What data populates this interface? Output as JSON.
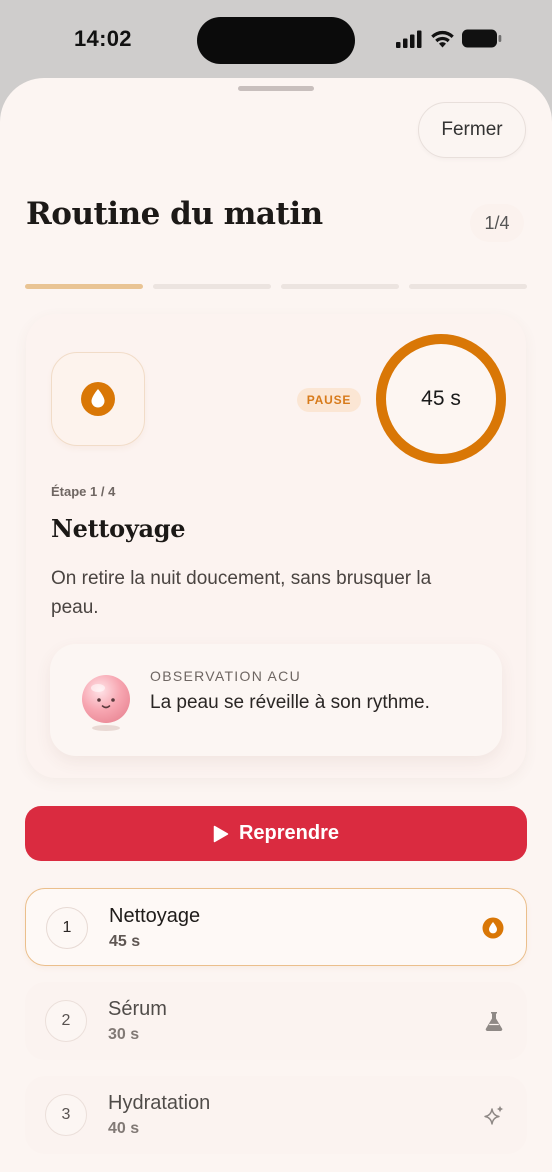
{
  "status_bar": {
    "time": "14:02"
  },
  "sheet": {
    "close_label": "Fermer",
    "title": "Routine du matin",
    "counter": "1/4"
  },
  "progress": {
    "total": 4,
    "current": 1
  },
  "current_step": {
    "badge": "PAUSE",
    "timer": "45 s",
    "timer_fraction": 1.0,
    "eyebrow": "Étape 1 / 4",
    "title": "Nettoyage",
    "description": "On retire la nuit doucement, sans brusquer la peau.",
    "observation": {
      "label": "OBSERVATION ACU",
      "text": "La peau se réveille à son rythme."
    }
  },
  "resume_button": {
    "label": "Reprendre"
  },
  "steps": [
    {
      "number": "1",
      "name": "Nettoyage",
      "duration": "45 s",
      "icon": "droplet-icon"
    },
    {
      "number": "2",
      "name": "Sérum",
      "duration": "30 s",
      "icon": "flask-icon"
    },
    {
      "number": "3",
      "name": "Hydratation",
      "duration": "40 s",
      "icon": "sparkle-icon"
    }
  ],
  "colors": {
    "accent_orange": "#d97706",
    "resume_red": "#da2b40",
    "progress_active": "#e9c494",
    "background": "#fcf5f2"
  }
}
